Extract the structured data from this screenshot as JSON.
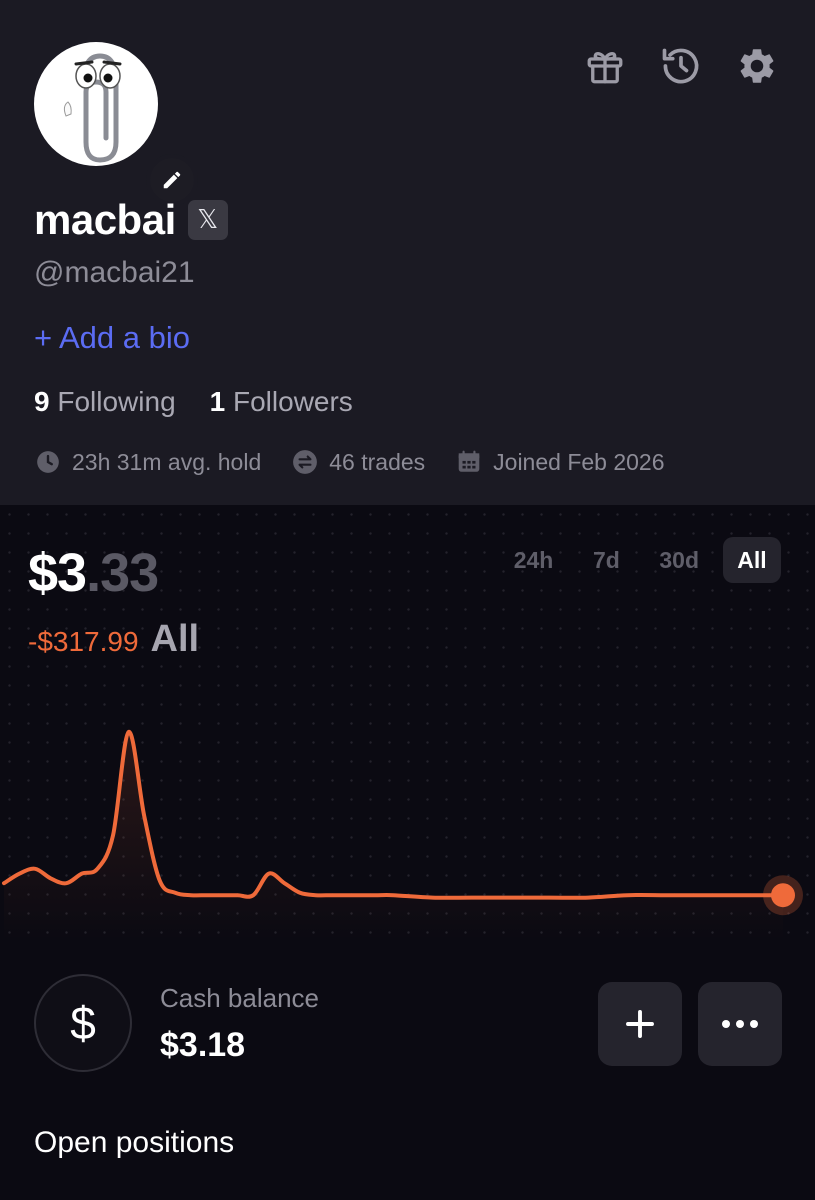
{
  "profile": {
    "display_name": "macbai",
    "x_badge": "𝕏",
    "handle": "@macbai21",
    "add_bio": "+ Add a bio",
    "following_count": "9",
    "following_label": "Following",
    "followers_count": "1",
    "followers_label": "Followers",
    "stats": {
      "avg_hold": "23h 31m avg. hold",
      "trades": "46 trades",
      "joined": "Joined Feb 2026"
    }
  },
  "icons": [
    "gift-icon",
    "history-icon",
    "gear-icon",
    "pencil-icon",
    "clock-icon",
    "swap-icon",
    "calendar-icon",
    "dollar-icon",
    "plus-icon",
    "more-icon"
  ],
  "portfolio": {
    "value_dollars": "$3",
    "value_cents": ".33",
    "pnl_delta": "-$317.99",
    "pnl_period": "All",
    "ranges": [
      "24h",
      "7d",
      "30d",
      "All"
    ],
    "active_range": "All"
  },
  "cash": {
    "symbol": "$",
    "label": "Cash balance",
    "value": "$3.18"
  },
  "sections": {
    "open_positions": "Open positions"
  },
  "colors": {
    "accent_line": "#ef6a3a",
    "link": "#5b6cf3",
    "background": "#0b0a12",
    "card": "#1b1a23"
  },
  "chart_data": {
    "type": "line",
    "title": "",
    "xlabel": "",
    "ylabel": "",
    "x": [
      0,
      2,
      4,
      6,
      8,
      10,
      12,
      14,
      16,
      18,
      20,
      22,
      24,
      26,
      28,
      30,
      32,
      34,
      36,
      38,
      40,
      42,
      44,
      46,
      48,
      50,
      55,
      60,
      65,
      70,
      75,
      80,
      85,
      90,
      95,
      100
    ],
    "y": [
      32,
      36,
      38,
      34,
      32,
      36,
      38,
      52,
      95,
      60,
      33,
      28,
      27,
      27,
      27,
      27,
      27,
      36,
      32,
      28,
      27,
      27,
      27,
      27,
      27,
      27,
      26,
      26,
      26,
      26,
      26,
      27,
      27,
      27,
      27,
      27
    ],
    "ylim": [
      0,
      100
    ],
    "grid": false,
    "end_marker": true
  }
}
